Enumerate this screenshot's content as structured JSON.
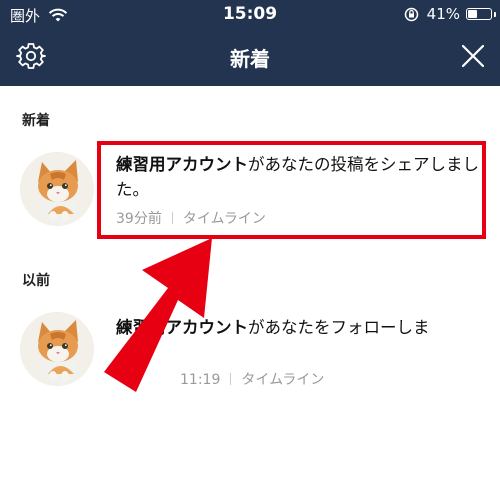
{
  "status_bar": {
    "carrier": "圏外",
    "time": "15:09",
    "battery": "41%",
    "battery_level": 0.41
  },
  "header": {
    "title": "新着"
  },
  "sections": {
    "new_label": "新着",
    "previous_label": "以前"
  },
  "notifications": [
    {
      "actor": "練習用アカウント",
      "message": "があなたの投稿をシェアしました。",
      "time": "39分前",
      "source": "タイムライン"
    },
    {
      "actor": "練習用アカウント",
      "message": "があなたをフォローしま",
      "time": "11:19",
      "source": "タイムライン"
    }
  ],
  "colors": {
    "header_bg": "#233450",
    "highlight": "#e60012"
  },
  "icons": [
    "wifi-icon",
    "rotation-lock-icon",
    "battery-icon",
    "gear-icon",
    "close-icon",
    "arrow-annotation"
  ]
}
